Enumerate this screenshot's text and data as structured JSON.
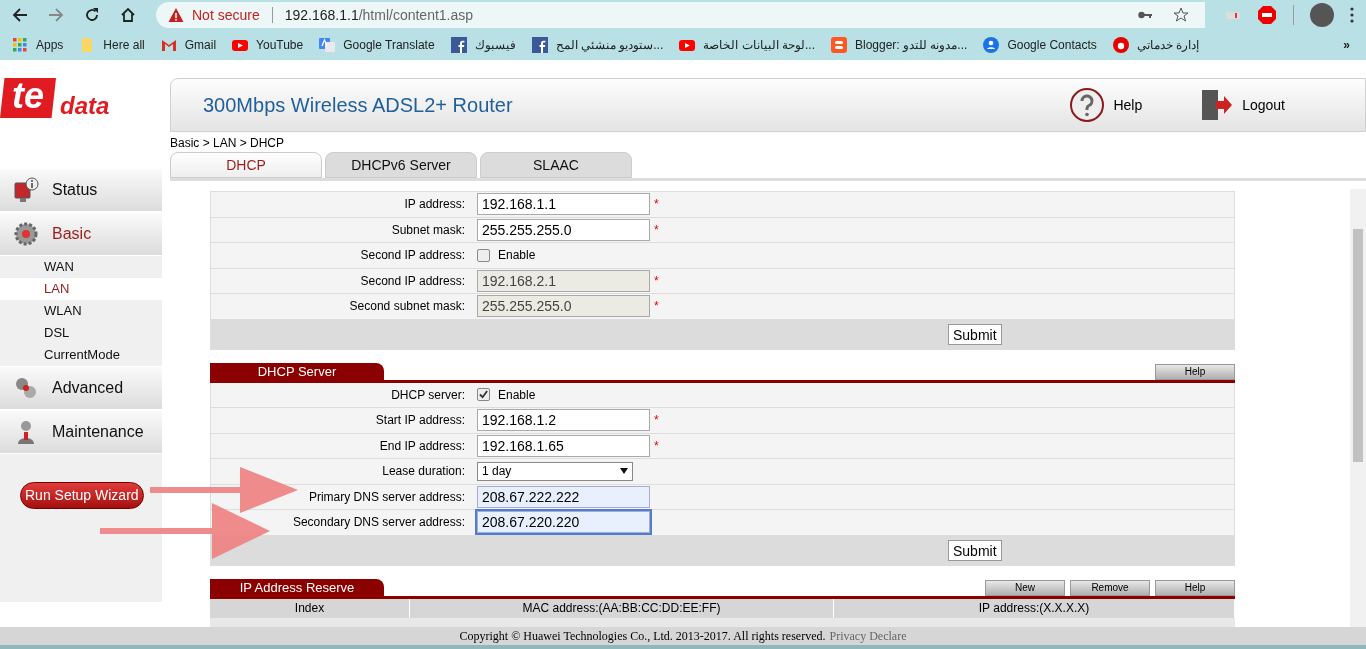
{
  "browser": {
    "security": "Not secure",
    "url_host": "192.168.1.1",
    "url_path": "/html/content1.asp",
    "bookmarks": [
      {
        "kind": "apps",
        "label": "Apps"
      },
      {
        "kind": "folder",
        "label": "Here all"
      },
      {
        "kind": "gmail",
        "label": "Gmail"
      },
      {
        "kind": "youtube",
        "label": "YouTube"
      },
      {
        "kind": "translate",
        "label": "Google Translate"
      },
      {
        "kind": "facebook",
        "label": "فيسبوك"
      },
      {
        "kind": "facebook",
        "label": "ستوديو منشئي المح..."
      },
      {
        "kind": "youtube",
        "label": "لوحة البيانات الخاصة..."
      },
      {
        "kind": "blogger",
        "label": "Blogger: مدونه للتدو..."
      },
      {
        "kind": "contacts",
        "label": "Google Contacts"
      },
      {
        "kind": "vodafone",
        "label": "إدارة خدماتي"
      }
    ],
    "more": "»"
  },
  "logo": {
    "mark": "te",
    "word": "data"
  },
  "header": {
    "title": "300Mbps Wireless ADSL2+ Router",
    "help": "Help",
    "logout": "Logout"
  },
  "sidebar": {
    "items": [
      {
        "kind": "status",
        "label": "Status",
        "selected": false
      },
      {
        "kind": "basic",
        "label": "Basic",
        "selected": true,
        "children": [
          {
            "label": "WAN",
            "selected": false
          },
          {
            "label": "LAN",
            "selected": true
          },
          {
            "label": "WLAN",
            "selected": false
          },
          {
            "label": "DSL",
            "selected": false
          },
          {
            "label": "CurrentMode",
            "selected": false
          }
        ]
      },
      {
        "kind": "advanced",
        "label": "Advanced",
        "selected": false
      },
      {
        "kind": "maintenance",
        "label": "Maintenance",
        "selected": false
      }
    ],
    "wizard": "Run Setup Wizard"
  },
  "breadcrumb": "Basic > LAN > DHCP",
  "tabs": [
    {
      "label": "DHCP",
      "selected": true
    },
    {
      "label": "DHCPv6 Server",
      "selected": false
    },
    {
      "label": "SLAAC",
      "selected": false
    }
  ],
  "lan": {
    "rows": [
      {
        "kind": "input",
        "label": "IP address:",
        "value": "192.168.1.1",
        "required": "*",
        "disabled": false
      },
      {
        "kind": "input",
        "label": "Subnet mask:",
        "value": "255.255.255.0",
        "required": "*",
        "disabled": false
      },
      {
        "kind": "checkbox",
        "label": "Second IP address:",
        "value": "Enable",
        "checked": false
      },
      {
        "kind": "input",
        "label": "Second IP address:",
        "value": "192.168.2.1",
        "required": "*",
        "disabled": true
      },
      {
        "kind": "input",
        "label": "Second subnet mask:",
        "value": "255.255.255.0",
        "required": "*",
        "disabled": true
      }
    ],
    "submit": "Submit"
  },
  "dhcp": {
    "title": "DHCP Server",
    "help": "Help",
    "rows": [
      {
        "kind": "checkbox",
        "label": "DHCP server:",
        "value": "Enable",
        "checked": true
      },
      {
        "kind": "input",
        "label": "Start IP address:",
        "value": "192.168.1.2",
        "required": "*",
        "disabled": false,
        "focused": false
      },
      {
        "kind": "input",
        "label": "End IP address:",
        "value": "192.168.1.65",
        "required": "*",
        "disabled": false,
        "focused": false
      },
      {
        "kind": "select",
        "label": "Lease duration:",
        "value": "1 day"
      },
      {
        "kind": "input",
        "label": "Primary DNS server address:",
        "value": "208.67.222.222",
        "disabled": false,
        "focused": false,
        "autofill": true
      },
      {
        "kind": "input",
        "label": "Secondary DNS server address:",
        "value": "208.67.220.220",
        "disabled": false,
        "focused": true,
        "autofill": true
      }
    ],
    "submit": "Submit"
  },
  "reserve": {
    "title": "IP Address Reserve",
    "buttons": [
      "New",
      "Remove",
      "Help"
    ],
    "columns": [
      "Index",
      "MAC address:(AA:BB:CC:DD:EE:FF)",
      "IP address:(X.X.X.X)"
    ]
  },
  "footer": {
    "text": "Copyright © Huawei Technologies Co., Ltd. 2013-2017. All rights reserved.",
    "link": "Privacy Declare"
  }
}
